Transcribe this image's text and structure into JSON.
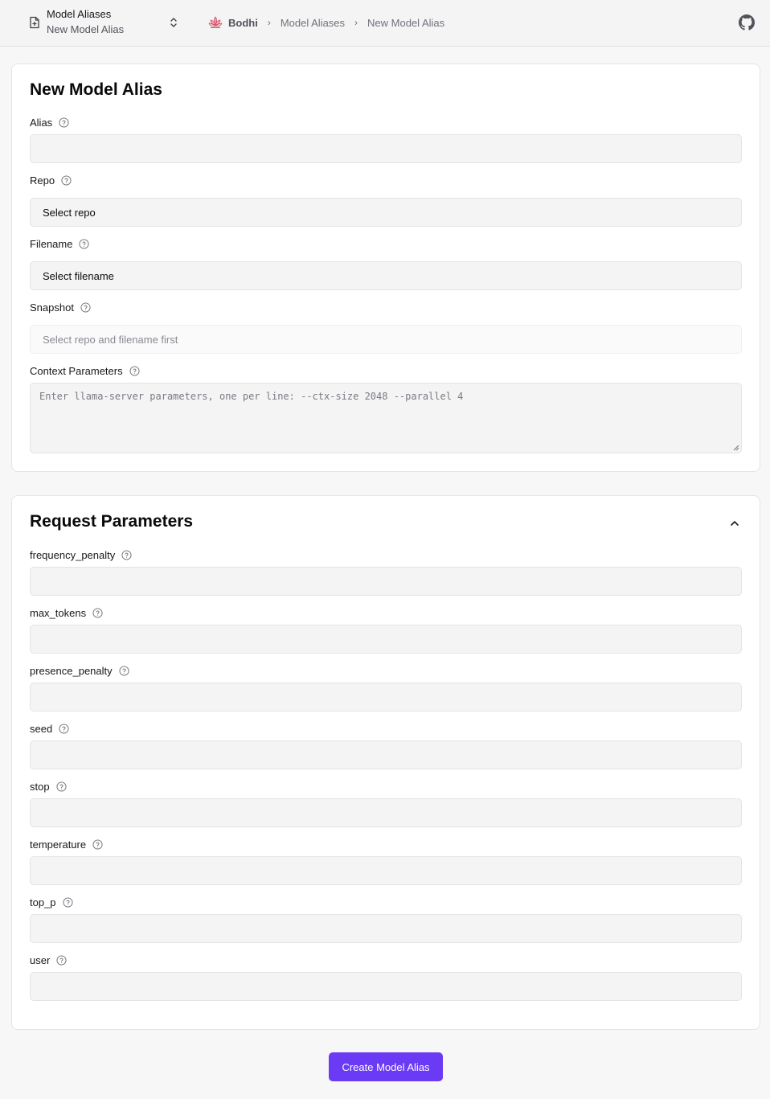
{
  "header": {
    "switcher_title": "Model Aliases",
    "switcher_subtitle": "New Model Alias",
    "breadcrumb": [
      "Bodhi",
      "Model Aliases",
      "New Model Alias"
    ]
  },
  "form": {
    "title": "New Model Alias",
    "alias_label": "Alias",
    "alias_value": "",
    "repo_label": "Repo",
    "repo_value": "Select repo",
    "filename_label": "Filename",
    "filename_value": "Select filename",
    "snapshot_label": "Snapshot",
    "snapshot_value": "Select repo and filename first",
    "context_label": "Context Parameters",
    "context_placeholder": "Enter llama-server parameters, one per line: --ctx-size 2048 --parallel 4"
  },
  "request": {
    "title": "Request Parameters",
    "fields": [
      {
        "label": "frequency_penalty",
        "value": ""
      },
      {
        "label": "max_tokens",
        "value": ""
      },
      {
        "label": "presence_penalty",
        "value": ""
      },
      {
        "label": "seed",
        "value": ""
      },
      {
        "label": "stop",
        "value": ""
      },
      {
        "label": "temperature",
        "value": ""
      },
      {
        "label": "top_p",
        "value": ""
      },
      {
        "label": "user",
        "value": ""
      }
    ]
  },
  "submit_label": "Create Model Alias",
  "colors": {
    "accent": "#6b3af5",
    "page_bg": "#f7f7f8",
    "input_bg": "#f4f4f5",
    "border": "#e4e4e7"
  }
}
